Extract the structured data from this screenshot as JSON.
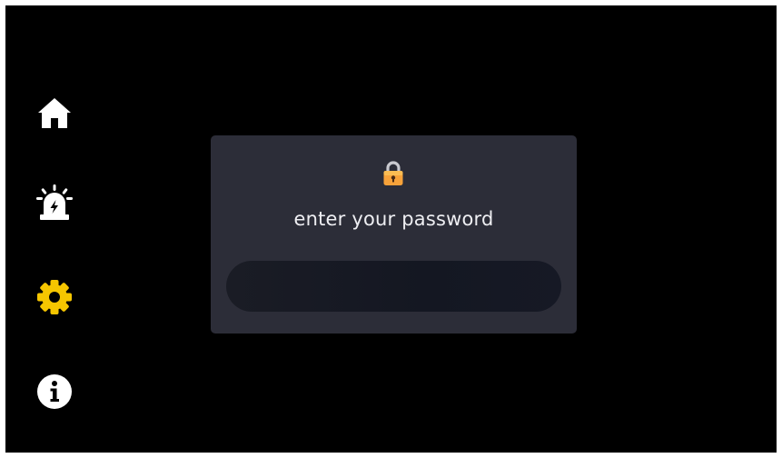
{
  "sidebar": {
    "items": [
      {
        "icon": "home-icon",
        "active": false
      },
      {
        "icon": "alarm-icon",
        "active": false
      },
      {
        "icon": "gear-icon",
        "active": true
      },
      {
        "icon": "info-icon",
        "active": false
      }
    ]
  },
  "dialog": {
    "icon": "lock-icon",
    "prompt": "enter your password",
    "password_value": "",
    "password_placeholder": ""
  },
  "colors": {
    "background": "#000000",
    "icon_default": "#ffffff",
    "icon_active": "#f6c600",
    "dialog_bg": "#2c2d38",
    "input_bg": "#161925",
    "text": "#eeeef2",
    "lock_body": "#f7a23a",
    "lock_shackle": "#c9c9cf"
  }
}
